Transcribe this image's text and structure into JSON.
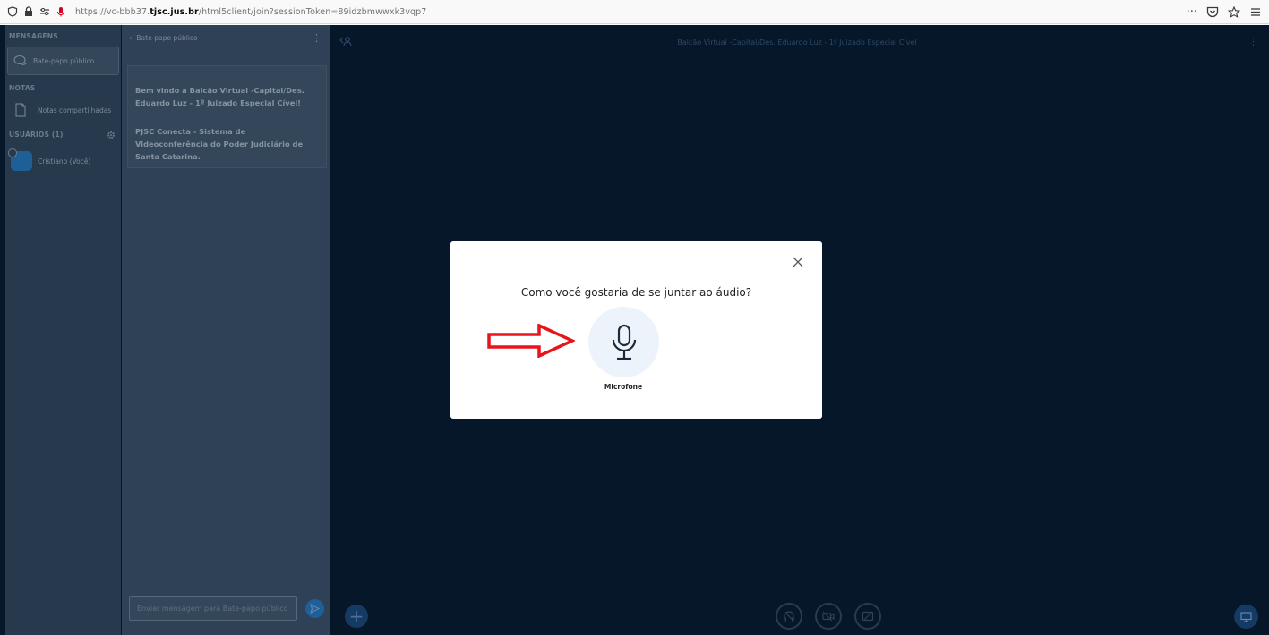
{
  "browser": {
    "url_prefix": "https://vc-bbb37.",
    "url_domain": "tjsc.jus.br",
    "url_suffix": "/html5client/join?sessionToken=89idzbmwwxk3vqp7",
    "menu_dots": "···"
  },
  "userpanel": {
    "messages_heading": "MENSAGENS",
    "public_chat": "Bate-papo público",
    "notes_heading": "NOTAS",
    "shared_notes": "Notas compartilhadas",
    "users_heading": "USUÁRIOS (1)",
    "user_name": "Cristiano (Você)"
  },
  "chatpanel": {
    "header": "Bate-papo público",
    "welcome_1": "Bem vindo a Balcão Virtual -Capital/Des. Eduardo Luz - 1º Juizado Especial Cível!",
    "welcome_2": "PJSC Conecta - Sistema de Videoconferência do Poder Judiciário de Santa Catarina.",
    "input_placeholder": "Enviar mensagem para Bate-papo público"
  },
  "presentation": {
    "title": "Balcão Virtual -Capital/Des. Eduardo Luz - 1º Juizado Especial Cível"
  },
  "modal": {
    "title": "Como você gostaria de se juntar ao áudio?",
    "mic_label": "Microfone"
  },
  "colors": {
    "arrow": "#e8141b",
    "accent": "#1f5f98"
  }
}
